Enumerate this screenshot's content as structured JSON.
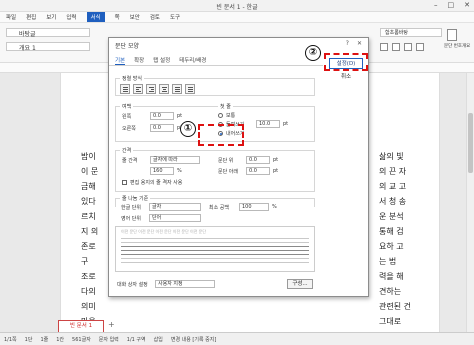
{
  "window": {
    "title": "빈 문서 1 - 한글",
    "controls": [
      "–",
      "□",
      "✕"
    ]
  },
  "menu": {
    "items": [
      "파일",
      "편집",
      "보기",
      "입력",
      "서식",
      "쪽",
      "보안",
      "검토",
      "도구"
    ],
    "active_index": 4
  },
  "ribbon": {
    "style_name": "바탕글",
    "style_sample": "개요 1",
    "font_name": "함초롬바탕",
    "labels": [
      "문단 번호",
      "개요",
      "스타일"
    ]
  },
  "document": {
    "lines": [
      "밤이",
      "이 문",
      "금해",
      "있다",
      "르치",
      "지 의",
      "존로",
      "구",
      "조로",
      "다의",
      "의미",
      "마을"
    ],
    "right_lines": [
      "삶의 빛",
      "의 끈 자",
      "의 교 고",
      "서 청 송",
      "운 분석",
      "통해 검",
      "요하 고",
      "는 법",
      "력을 해",
      "견하는",
      "관련된 건",
      "그대로"
    ],
    "tab_name": "빈 문서 1"
  },
  "status": {
    "items": [
      "1/1쪽",
      "1단",
      "1줄",
      "1칸",
      "561글자",
      "문자 입력",
      "1/1 구역",
      "삽입",
      "변경 내용 [기록 중지]"
    ]
  },
  "dialog": {
    "title": "문단 모양",
    "help": "?",
    "close": "✕",
    "tabs": [
      "기본",
      "확장",
      "탭 설정",
      "테두리/배경"
    ],
    "active_tab": 0,
    "section_align": "정렬 방식",
    "section_margin": "여백",
    "left_label": "왼쪽",
    "left_value": "0.0",
    "right_label": "오른쪽",
    "right_value": "0.0",
    "unit": "pt",
    "first_line_label": "첫 줄",
    "normal_label": "보통",
    "indent_label": "들여쓰기",
    "outdent_label": "내어쓰기",
    "indent_value": "10.0",
    "section_spacing": "간격",
    "line_spacing_label": "줄 간격",
    "line_spacing_type": "글자에 따라",
    "line_spacing_value": "160",
    "percent": "%",
    "before_label": "문단 위",
    "before_value": "0.0",
    "after_label": "문단 아래",
    "after_value": "0.0",
    "grid_check": "편집 용지의 줄 격자 사용",
    "section_break": "줄 나눔 기준",
    "korean_unit_label": "한글 단위",
    "korean_unit_value": "글자",
    "min_space_label": "최소 공백",
    "min_space_value": "100",
    "english_unit_label": "영어 단위",
    "english_unit_value": "단어",
    "preview_text": "이전 문단 이전 문단 이전 문단 이전 문단 이전 문단",
    "dialog_settings_label": "대화 상자 설정",
    "dialog_settings_value": "사용자 지정",
    "compose_button": "구성...",
    "set_button": "설정(D)",
    "cancel_button": "취소"
  },
  "annotations": {
    "marker_1": "①",
    "marker_2": "②"
  }
}
